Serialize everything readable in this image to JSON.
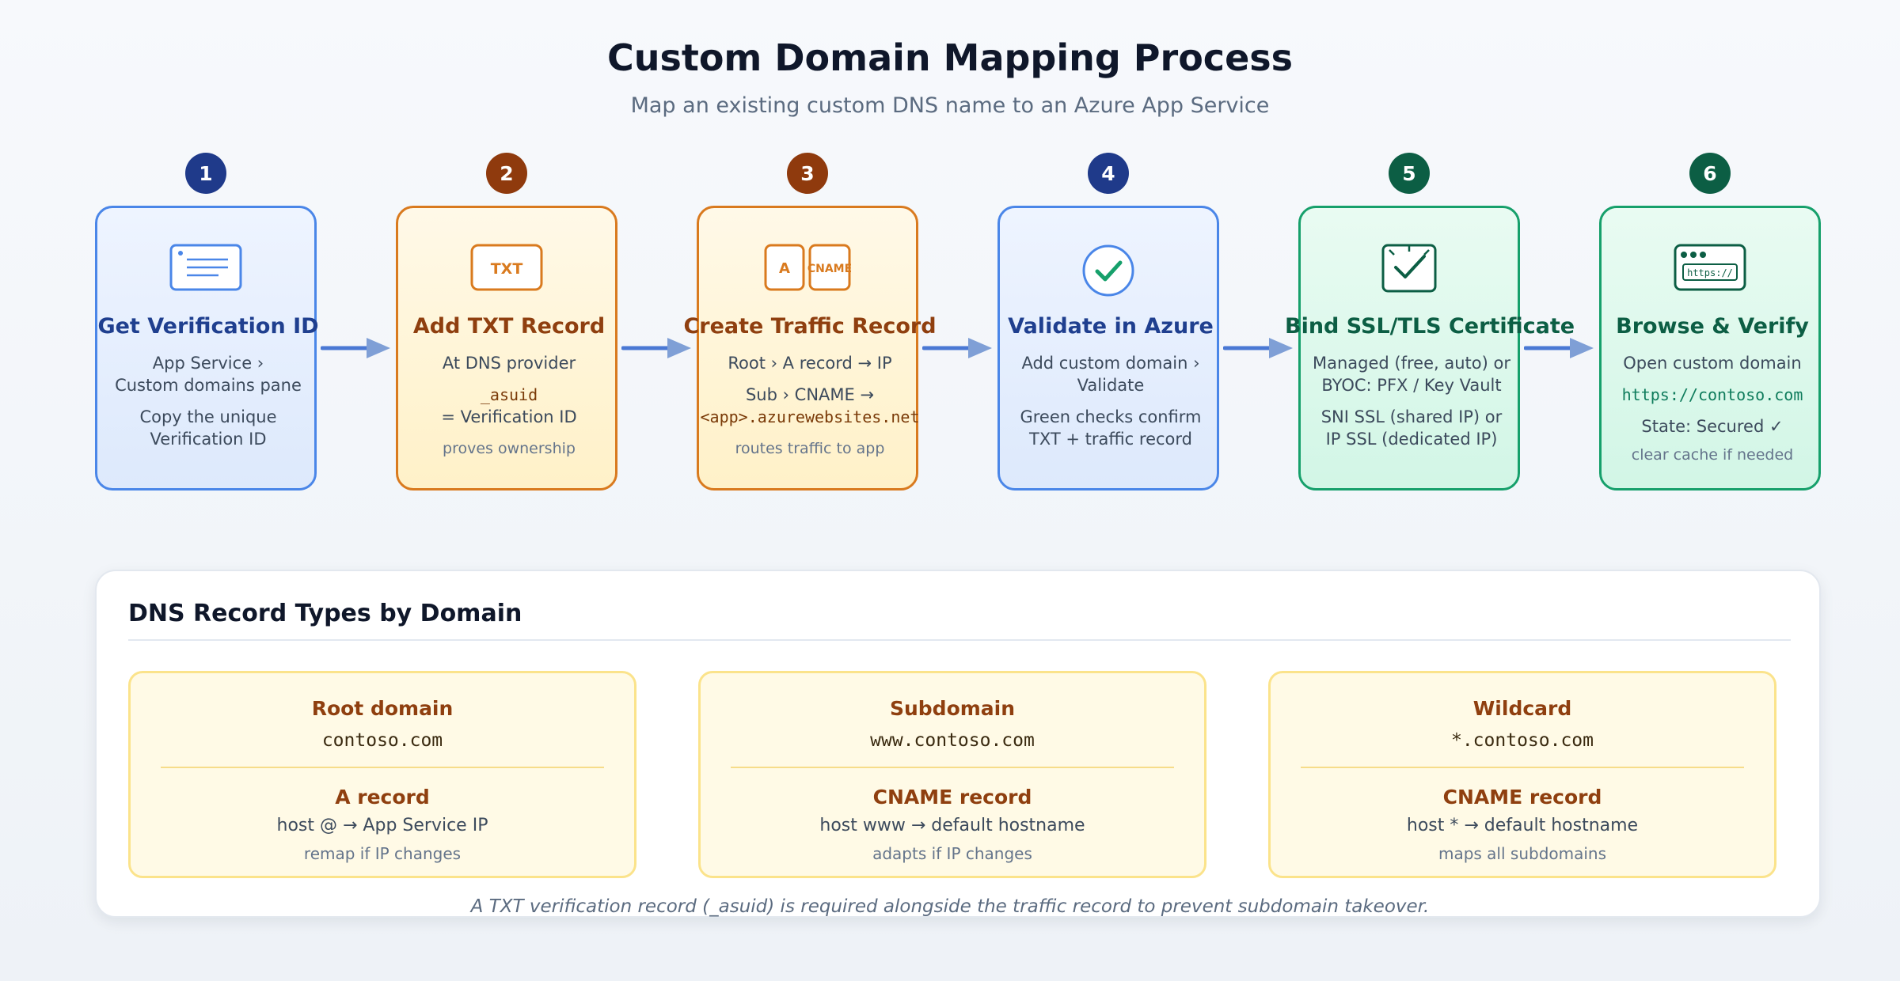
{
  "header": {
    "title": "Custom Domain Mapping Process",
    "subtitle": "Map an existing custom DNS name to an Azure App Service"
  },
  "colors": {
    "blue": "#4a86e8",
    "orange": "#d97a1e",
    "green": "#16a06b",
    "badge_blue": "#1f3a8a",
    "badge_orange": "#8f3a0d",
    "badge_green": "#0c5e44",
    "arrow": "#4a78d4"
  },
  "steps": [
    {
      "number": "1",
      "icon": "document-icon",
      "title": "Get Verification ID",
      "lines": [
        "App Service ›",
        "Custom domains pane"
      ],
      "lines2": [
        "Copy the unique",
        "Verification ID"
      ]
    },
    {
      "number": "2",
      "icon": "txt-record-icon",
      "icon_label": "TXT",
      "title": "Add TXT Record",
      "lines": [
        "At DNS provider"
      ],
      "code": "_asuid",
      "code_after": "= Verification ID",
      "note": "proves ownership"
    },
    {
      "number": "3",
      "icon": "a-cname-record-icon",
      "icon_label_a": "A",
      "icon_label_b": "CNAME",
      "title": "Create Traffic Record",
      "lines": [
        "Root › A record → IP"
      ],
      "lines2": [
        "Sub › CNAME →"
      ],
      "code": "<app>.azurewebsites.net",
      "note": "routes traffic to app"
    },
    {
      "number": "4",
      "icon": "check-circle-icon",
      "title": "Validate in Azure",
      "lines": [
        "Add custom domain ›",
        "Validate"
      ],
      "lines2": [
        "Green checks confirm",
        "TXT + traffic record"
      ]
    },
    {
      "number": "5",
      "icon": "certificate-icon",
      "title": "Bind SSL/TLS Certificate",
      "lines": [
        "Managed (free, auto) or",
        "BYOC: PFX / Key Vault"
      ],
      "lines2": [
        "SNI SSL (shared IP) or",
        "IP SSL (dedicated IP)"
      ]
    },
    {
      "number": "6",
      "icon": "browser-icon",
      "icon_label": "https://",
      "title": "Browse & Verify",
      "lines": [
        "Open custom domain"
      ],
      "code": "https://contoso.com",
      "status": "State: Secured ✓",
      "note": "clear cache if needed"
    }
  ],
  "dns_panel": {
    "title": "DNS Record Types by Domain",
    "cards": [
      {
        "type": "Root domain",
        "domain": "contoso.com",
        "record": "A record",
        "host": "host @ → App Service IP",
        "note": "remap if IP changes"
      },
      {
        "type": "Subdomain",
        "domain": "www.contoso.com",
        "record": "CNAME record",
        "host": "host www → default hostname",
        "note": "adapts if IP changes"
      },
      {
        "type": "Wildcard",
        "domain": "*.contoso.com",
        "record": "CNAME record",
        "host": "host * → default hostname",
        "note": "maps all subdomains"
      }
    ],
    "footnote": "A TXT verification record (_asuid) is required alongside the traffic record to prevent subdomain takeover."
  }
}
